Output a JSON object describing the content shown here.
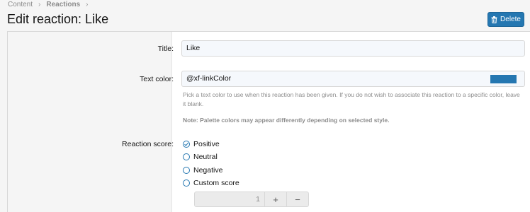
{
  "breadcrumb": {
    "items": [
      "Content",
      "Reactions"
    ]
  },
  "page": {
    "title": "Edit reaction: Like"
  },
  "toolbar": {
    "delete_label": "Delete"
  },
  "form": {
    "title_label": "Title:",
    "title_value": "Like",
    "text_color_label": "Text color:",
    "text_color_value": "@xf-linkColor",
    "text_color_swatch": "#2577b1",
    "text_color_hint": "Pick a text color to use when this reaction has been given. If you do not wish to associate this reaction to a specific color, leave it blank.",
    "text_color_note": "Note: Palette colors may appear differently depending on selected style.",
    "reaction_score_label": "Reaction score:",
    "score_options": [
      "Positive",
      "Neutral",
      "Negative",
      "Custom score"
    ],
    "score_selected": "Positive",
    "custom_score_value": "1",
    "stepper_plus": "+",
    "stepper_minus": "−"
  },
  "colors": {
    "accent": "#2577b1",
    "background": "#f5f5f5"
  }
}
